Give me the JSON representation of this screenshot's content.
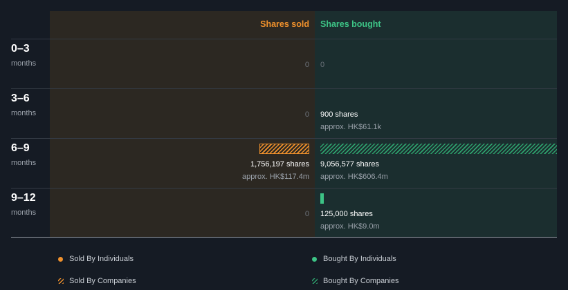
{
  "chart_data": {
    "type": "bar",
    "headers": {
      "sold": "Shares sold",
      "bought": "Shares bought"
    },
    "periods": [
      {
        "label": "0–3",
        "sub": "months",
        "sold": {
          "value": 0,
          "individuals": 0,
          "companies": 0,
          "text": "0",
          "approx": ""
        },
        "bought": {
          "value": 0,
          "individuals": 0,
          "companies": 0,
          "text": "0",
          "approx": ""
        }
      },
      {
        "label": "3–6",
        "sub": "months",
        "sold": {
          "value": 0,
          "individuals": 0,
          "companies": 0,
          "text": "0",
          "approx": ""
        },
        "bought": {
          "value": 900,
          "individuals": 900,
          "companies": 0,
          "text": "900 shares",
          "approx": "approx. HK$61.1k"
        }
      },
      {
        "label": "6–9",
        "sub": "months",
        "sold": {
          "value": 1756197,
          "individuals": 0,
          "companies": 1756197,
          "text": "1,756,197 shares",
          "approx": "approx. HK$117.4m"
        },
        "bought": {
          "value": 9056577,
          "individuals": 0,
          "companies": 9056577,
          "text": "9,056,577 shares",
          "approx": "approx. HK$606.4m"
        }
      },
      {
        "label": "9–12",
        "sub": "months",
        "sold": {
          "value": 0,
          "individuals": 0,
          "companies": 0,
          "text": "0",
          "approx": ""
        },
        "bought": {
          "value": 125000,
          "individuals": 125000,
          "companies": 0,
          "text": "125,000 shares",
          "approx": "approx. HK$9.0m"
        }
      }
    ],
    "legend": [
      {
        "label": "Sold By Individuals",
        "color": "#f0912c",
        "style": "solid"
      },
      {
        "label": "Bought By Individuals",
        "color": "#3dc486",
        "style": "solid"
      },
      {
        "label": "Sold By Companies",
        "color": "#f0912c",
        "style": "hatched"
      },
      {
        "label": "Bought By Companies",
        "color": "#3dc486",
        "style": "hatched"
      }
    ],
    "colors": {
      "sold": "#f0912c",
      "bought": "#3dc486"
    }
  }
}
